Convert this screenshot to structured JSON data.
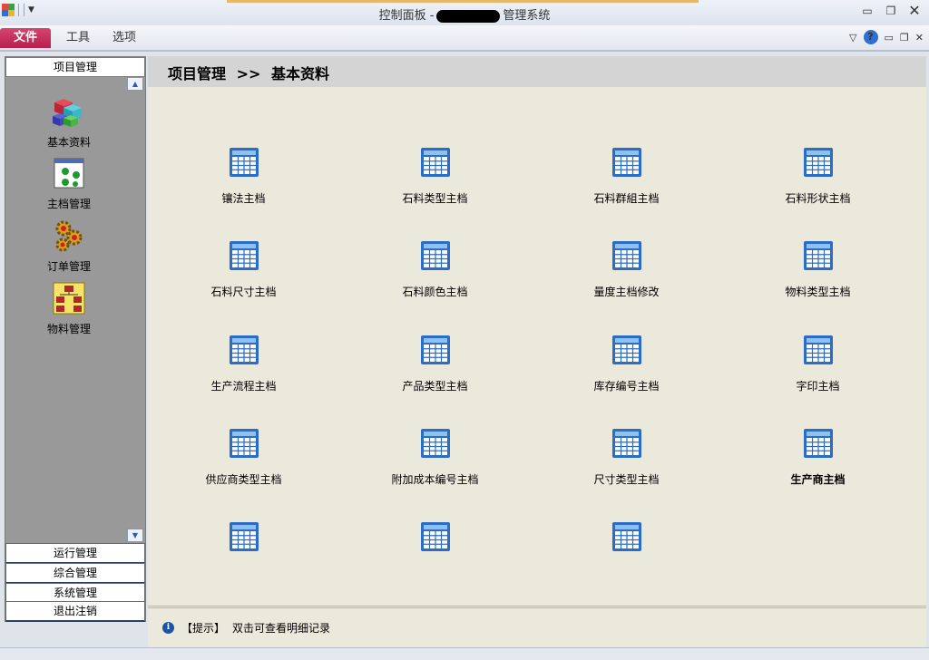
{
  "window": {
    "title_prefix": "控制面板 -",
    "title_suffix": "管理系统"
  },
  "ribbon": {
    "tabs": [
      {
        "label": "文件"
      },
      {
        "label": "工具"
      },
      {
        "label": "选项"
      }
    ]
  },
  "sidebar": {
    "header": "项目管理",
    "items": [
      {
        "label": "基本资料",
        "icon": "cubes-icon"
      },
      {
        "label": "主档管理",
        "icon": "nodes-window-icon"
      },
      {
        "label": "订单管理",
        "icon": "gears-icon"
      },
      {
        "label": "物料管理",
        "icon": "org-chart-icon"
      }
    ],
    "groups": [
      "运行管理",
      "综合管理",
      "系统管理",
      "退出注销"
    ]
  },
  "main": {
    "breadcrumb": {
      "section": "项目管理",
      "separator": ">>",
      "page": "基本资料"
    },
    "tiles": [
      {
        "label": "镶法主档"
      },
      {
        "label": "石料类型主档"
      },
      {
        "label": "石料群組主档"
      },
      {
        "label": "石料形状主档"
      },
      {
        "label": "石料尺寸主档"
      },
      {
        "label": "石料颜色主档"
      },
      {
        "label": "量度主档修改"
      },
      {
        "label": "物料类型主档"
      },
      {
        "label": "生产流程主档"
      },
      {
        "label": "产品类型主档"
      },
      {
        "label": "库存编号主档"
      },
      {
        "label": "字印主档"
      },
      {
        "label": "供应商类型主档"
      },
      {
        "label": "附加成本编号主档"
      },
      {
        "label": "尺寸类型主档"
      },
      {
        "label": "生产商主档",
        "emphasis": true
      },
      {
        "label": ""
      },
      {
        "label": ""
      },
      {
        "label": ""
      }
    ],
    "hint": {
      "tag": "【提示】",
      "text": "双击可查看明细记录"
    }
  },
  "colors": {
    "file_tab": "#c8305c",
    "sidebar_bg": "#999999",
    "content_bg": "#ebe8dc",
    "header_bg": "#d4d4d4"
  }
}
